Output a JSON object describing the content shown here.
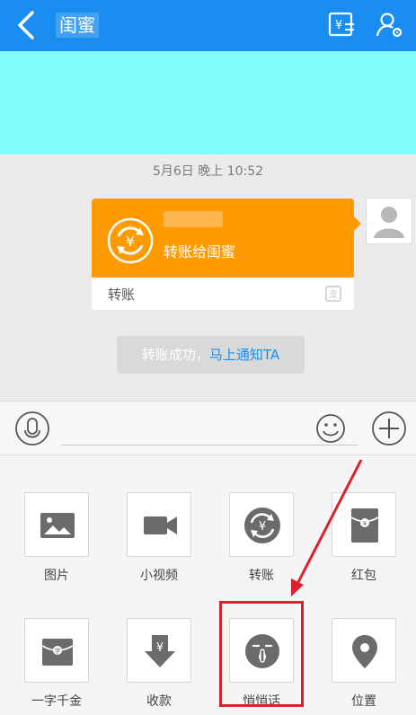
{
  "header": {
    "title": "闺蜜",
    "back_icon": "chevron-left-icon",
    "actions": [
      "transfer-icon",
      "friend-settings-icon"
    ],
    "color": "#1a8df0"
  },
  "chat": {
    "timestamp": "5月6日 晚上 10:52",
    "transfer_card": {
      "main_text": "转账给闺蜜",
      "label": "转账",
      "color": "#ff9a00"
    },
    "notice": {
      "prefix": "转账成功，",
      "link": "马上通知TA"
    }
  },
  "input_bar": {
    "icons": [
      "microphone-icon",
      "emoji-icon",
      "plus-icon"
    ]
  },
  "panel": {
    "items": [
      {
        "label": "图片",
        "icon": "image-icon"
      },
      {
        "label": "小视频",
        "icon": "video-icon"
      },
      {
        "label": "转账",
        "icon": "transfer-icon"
      },
      {
        "label": "红包",
        "icon": "red-packet-icon"
      },
      {
        "label": "一字千金",
        "icon": "word-packet-icon"
      },
      {
        "label": "收款",
        "icon": "receive-money-icon"
      },
      {
        "label": "悄悄话",
        "icon": "whisper-icon"
      },
      {
        "label": "位置",
        "icon": "location-icon"
      }
    ],
    "highlighted": "悄悄话",
    "highlight_color": "#d9212b"
  }
}
